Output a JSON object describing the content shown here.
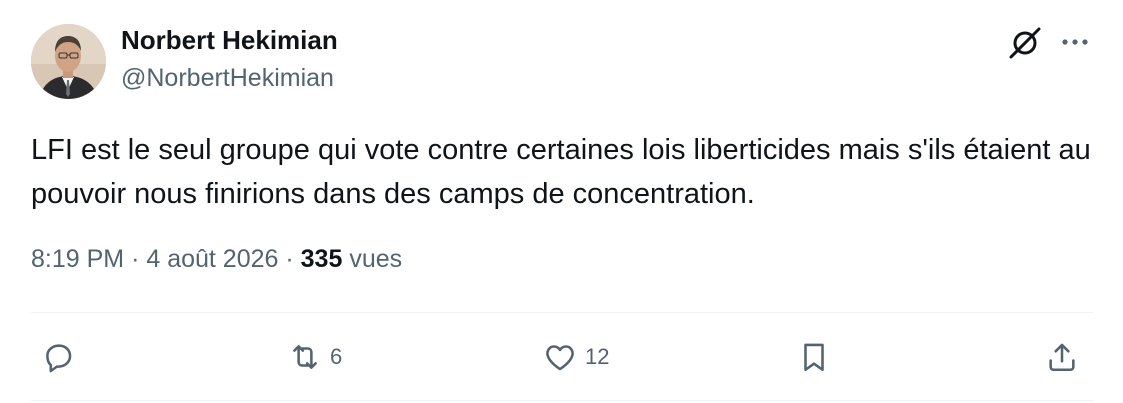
{
  "author": {
    "name": "Norbert Hekimian",
    "handle": "@NorbertHekimian"
  },
  "tweet": {
    "text": "LFI est le seul groupe qui vote contre certaines lois liberticides mais s'ils étaient au pouvoir nous finirions dans des camps de concentration.",
    "time": "8:19 PM",
    "date": "4 août 2026",
    "views_count": "335",
    "views_label": "vues"
  },
  "actions": {
    "reply_count": "",
    "retweet_count": "6",
    "like_count": "12"
  },
  "icons": {
    "grok": "grok-icon",
    "more": "more-dots-icon",
    "reply": "reply-icon",
    "retweet": "retweet-icon",
    "like": "heart-icon",
    "bookmark": "bookmark-icon",
    "share": "share-icon"
  },
  "colors": {
    "text_primary": "#0f1419",
    "text_secondary": "#536471",
    "divider": "#eff3f4"
  }
}
